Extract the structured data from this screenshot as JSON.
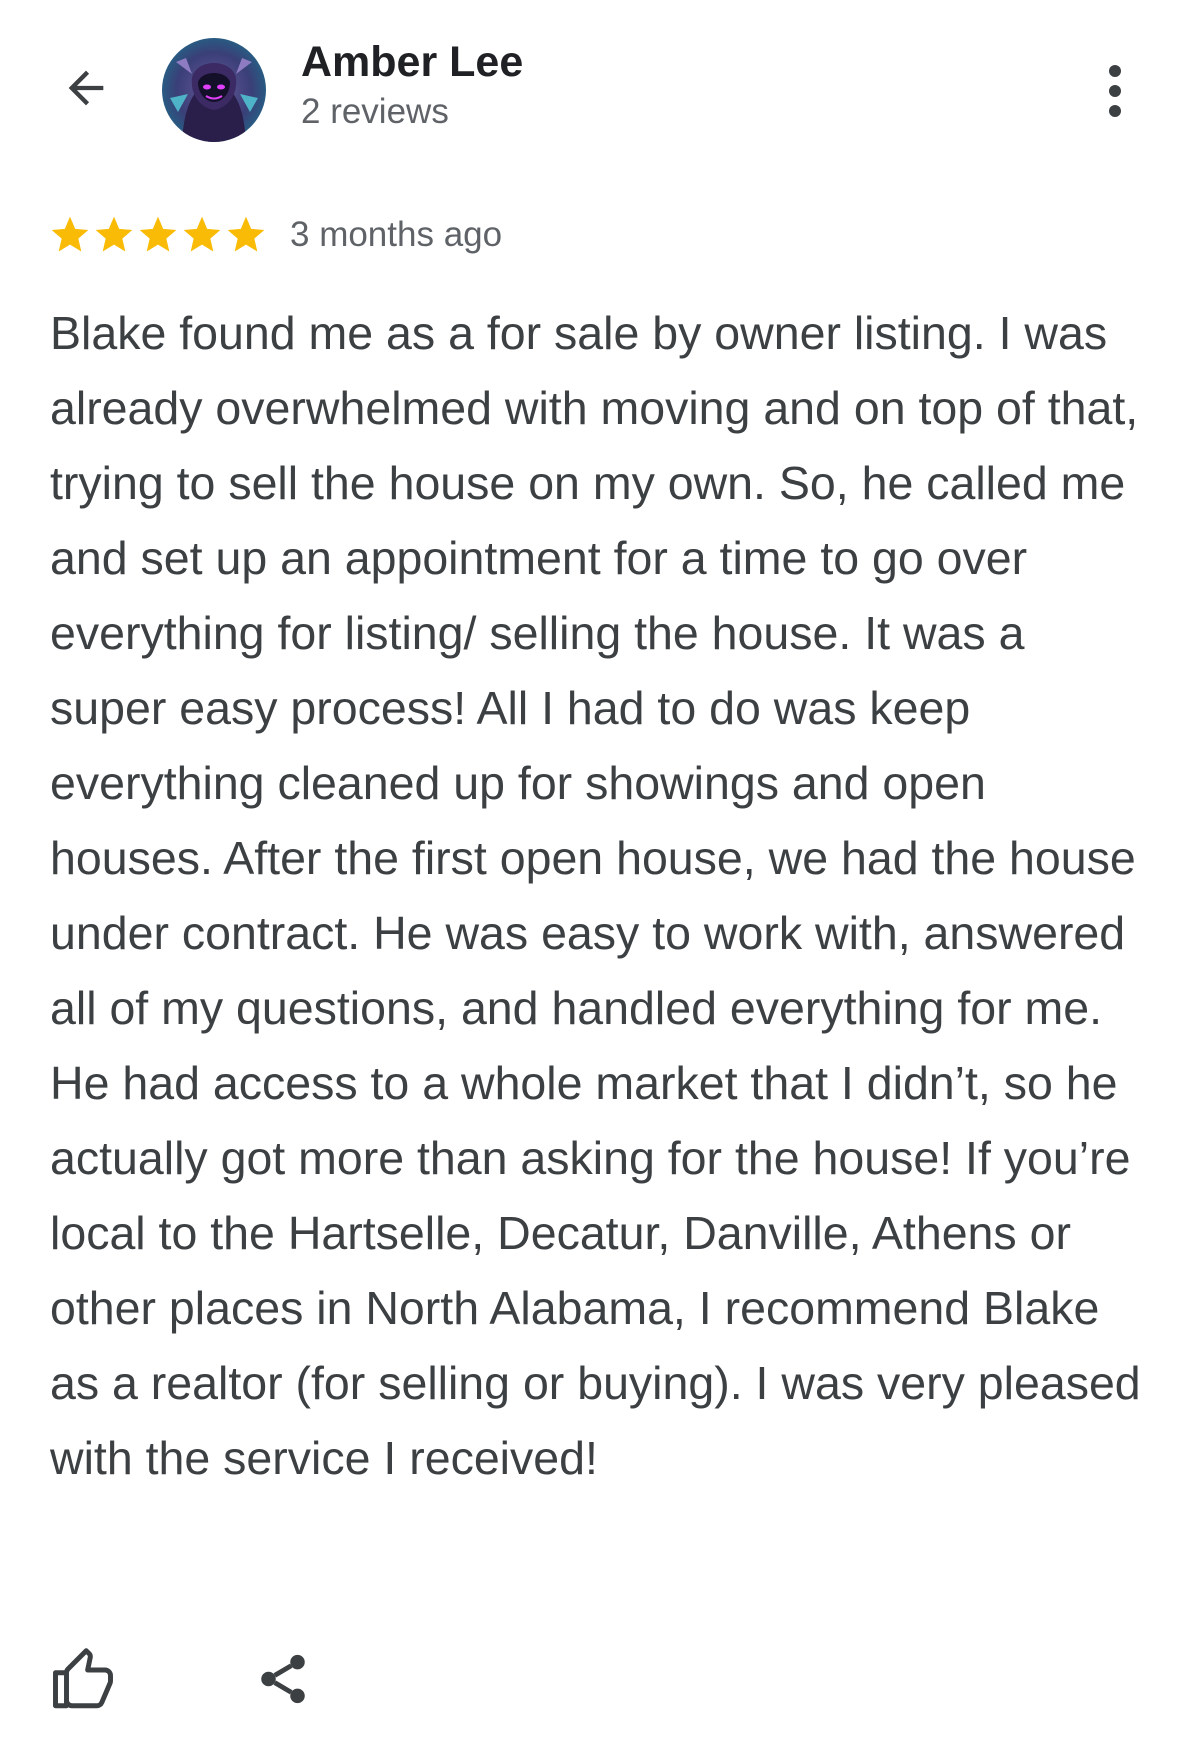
{
  "reviewer": {
    "name": "Amber Lee",
    "reviews_count": "2 reviews"
  },
  "review": {
    "rating": 5,
    "rating_max": 5,
    "date": "3 months ago",
    "text": "Blake found me as a for sale by owner listing. I was already overwhelmed with moving and on top of that, trying to sell the house on my own. So, he called me and set up an appointment for a time to go over everything for listing/ selling the house. It was a super easy process! All I had to do was keep everything cleaned up for showings and open houses. After the first open house, we had the house under contract. He was easy to work with, answered all of my questions, and handled everything for me. He had access to a whole market that I didn’t, so he actually got more than asking for the house! If you’re local to the Hartselle, Decatur, Danville, Athens or other places in North Alabama, I recommend Blake as a realtor (for selling or buying). I was very pleased with the service I received!"
  },
  "icons": {
    "back": "arrow-back-icon",
    "more": "more-vertical-icon",
    "star": "star-icon",
    "like": "thumb-up-icon",
    "share": "share-icon"
  },
  "colors": {
    "star": "#f9bb05",
    "name": "#202124",
    "secondary_text": "#5f6368",
    "body_text": "#3c4043",
    "icon": "#3c4043"
  }
}
